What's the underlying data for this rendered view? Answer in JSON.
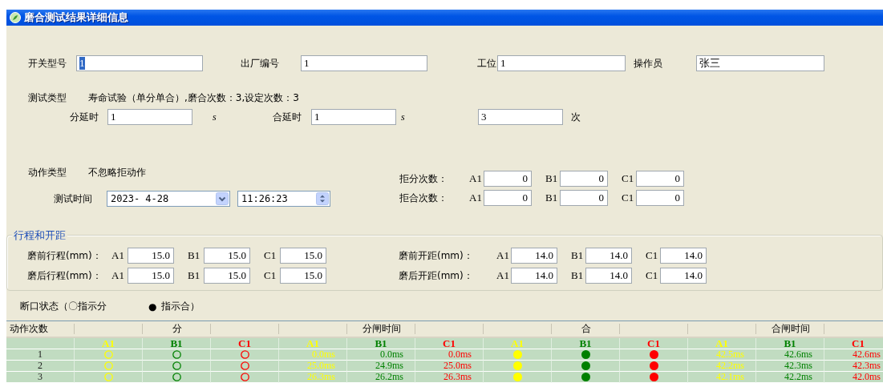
{
  "window": {
    "title": "磨合测试结果详细信息"
  },
  "fields": [
    {
      "label": "开关型号",
      "value": "1",
      "highlighted": true
    },
    {
      "label": "出厂编号",
      "value": "1",
      "highlighted": false
    },
    {
      "label": "工位",
      "value": "1",
      "highlighted": false
    },
    {
      "label": "操作员",
      "value": "张三",
      "highlighted": false
    }
  ],
  "test_type": {
    "label": "测试类型",
    "value": "寿命试验（单分单合）,磨合次数：3,设定次数：3"
  },
  "delays": {
    "open_delay": {
      "label": "分延时",
      "value": "1",
      "unit": "s"
    },
    "close_delay": {
      "label": "合延时",
      "value": "1",
      "unit": "s"
    },
    "count": {
      "value": "3",
      "unit": "次"
    }
  },
  "action_type": {
    "label": "动作类型",
    "value": "不忽略拒动作"
  },
  "test_time": {
    "label": "测试时间",
    "date": "2023- 4-28",
    "time": "11:26:23"
  },
  "refusals": [
    {
      "label": "拒分次数：",
      "phases": [
        {
          "label": "A1",
          "value": "0"
        },
        {
          "label": "B1",
          "value": "0"
        },
        {
          "label": "C1",
          "value": "0"
        }
      ]
    },
    {
      "label": "拒合次数：",
      "phases": [
        {
          "label": "A1",
          "value": "0"
        },
        {
          "label": "B1",
          "value": "0"
        },
        {
          "label": "C1",
          "value": "0"
        }
      ]
    }
  ],
  "stroke_group": {
    "title": "行程和开距",
    "rows": [
      {
        "left": {
          "label": "磨前行程(mm)：",
          "phases": [
            {
              "label": "A1",
              "value": "15.0"
            },
            {
              "label": "B1",
              "value": "15.0"
            },
            {
              "label": "C1",
              "value": "15.0"
            }
          ]
        },
        "right": {
          "label": "磨前开距(mm)：",
          "phases": [
            {
              "label": "A1",
              "value": "14.0"
            },
            {
              "label": "B1",
              "value": "14.0"
            },
            {
              "label": "C1",
              "value": "14.0"
            }
          ]
        }
      },
      {
        "left": {
          "label": "磨后行程(mm)：",
          "phases": [
            {
              "label": "A1",
              "value": "15.0"
            },
            {
              "label": "B1",
              "value": "15.0"
            },
            {
              "label": "C1",
              "value": "15.0"
            }
          ]
        },
        "right": {
          "label": "磨后开距(mm)：",
          "phases": [
            {
              "label": "A1",
              "value": "14.0"
            },
            {
              "label": "B1",
              "value": "14.0"
            },
            {
              "label": "C1",
              "value": "14.0"
            }
          ]
        }
      }
    ]
  },
  "legend": {
    "open_text": "断口状态（〇指示分",
    "closed_symbol": "●",
    "closed_text": "指示合）"
  },
  "table": {
    "first_column": "动作次数",
    "groups": [
      {
        "title": "分",
        "phases": [
          {
            "label": "A1",
            "color": "#ffff00"
          },
          {
            "label": "B1",
            "color": "#008000"
          },
          {
            "label": "C1",
            "color": "#ff0000"
          }
        ]
      },
      {
        "title": "分闸时间",
        "phases": [
          {
            "label": "A1",
            "color": "#ffff00"
          },
          {
            "label": "B1",
            "color": "#008000"
          },
          {
            "label": "C1",
            "color": "#ff0000"
          }
        ]
      },
      {
        "title": "合",
        "phases": [
          {
            "label": "A1",
            "color": "#ffff00"
          },
          {
            "label": "B1",
            "color": "#008000"
          },
          {
            "label": "C1",
            "color": "#ff0000"
          }
        ]
      },
      {
        "title": "合闸时间",
        "phases": [
          {
            "label": "A1",
            "color": "#ffff00"
          },
          {
            "label": "B1",
            "color": "#008000"
          },
          {
            "label": "C1",
            "color": "#ff0000"
          }
        ]
      }
    ],
    "rows": [
      {
        "number": "1",
        "cells": [
          {
            "kind": "state",
            "closed": false
          },
          {
            "kind": "state",
            "closed": false
          },
          {
            "kind": "state",
            "closed": false
          },
          {
            "kind": "time",
            "text": "0.0ms"
          },
          {
            "kind": "time",
            "text": "0.0ms"
          },
          {
            "kind": "time",
            "text": "0.0ms"
          },
          {
            "kind": "state",
            "closed": true
          },
          {
            "kind": "state",
            "closed": true
          },
          {
            "kind": "state",
            "closed": true
          },
          {
            "kind": "time",
            "text": "42.5ms"
          },
          {
            "kind": "time",
            "text": "42.6ms"
          },
          {
            "kind": "time",
            "text": "42.6ms"
          }
        ]
      },
      {
        "number": "2",
        "cells": [
          {
            "kind": "state",
            "closed": false
          },
          {
            "kind": "state",
            "closed": false
          },
          {
            "kind": "state",
            "closed": false
          },
          {
            "kind": "time",
            "text": "25.0ms"
          },
          {
            "kind": "time",
            "text": "24.9ms"
          },
          {
            "kind": "time",
            "text": "25.0ms"
          },
          {
            "kind": "state",
            "closed": true
          },
          {
            "kind": "state",
            "closed": true
          },
          {
            "kind": "state",
            "closed": true
          },
          {
            "kind": "time",
            "text": "42.2ms"
          },
          {
            "kind": "time",
            "text": "42.3ms"
          },
          {
            "kind": "time",
            "text": "42.3ms"
          }
        ]
      },
      {
        "number": "3",
        "cells": [
          {
            "kind": "state",
            "closed": false
          },
          {
            "kind": "state",
            "closed": false
          },
          {
            "kind": "state",
            "closed": false
          },
          {
            "kind": "time",
            "text": "26.3ms"
          },
          {
            "kind": "time",
            "text": "26.2ms"
          },
          {
            "kind": "time",
            "text": "26.3ms"
          },
          {
            "kind": "state",
            "closed": true
          },
          {
            "kind": "state",
            "closed": true
          },
          {
            "kind": "state",
            "closed": true
          },
          {
            "kind": "time",
            "text": "42.1ms"
          },
          {
            "kind": "time",
            "text": "42.2ms"
          },
          {
            "kind": "time",
            "text": "42.0ms"
          }
        ]
      }
    ]
  }
}
